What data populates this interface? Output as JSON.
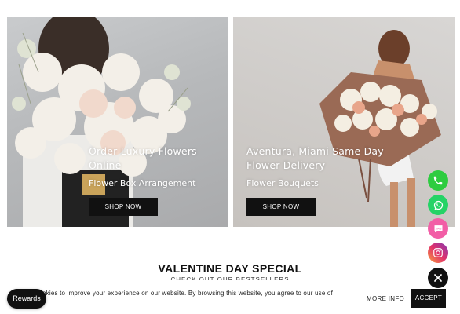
{
  "banners": [
    {
      "title_line1": "Order Luxury Flowers",
      "title_line2": "Online",
      "subtitle": "Flower Box Arrangement",
      "button": "SHOP NOW"
    },
    {
      "title_line1": "Aventura, Miami Same Day",
      "title_line2": "Flower Delivery",
      "subtitle": "Flower Bouquets",
      "button": "SHOP NOW"
    }
  ],
  "section": {
    "title": "VALENTINE DAY SPECIAL",
    "subtitle": "CHECK OUT OUR BESTSELLERS"
  },
  "cookie": {
    "text": "okies to improve your experience on our website. By browsing this website, you agree to our use of",
    "more_info": "MORE INFO",
    "accept": "ACCEPT"
  },
  "rewards": {
    "label": "Rewards"
  },
  "contact_buttons": [
    {
      "icon": "phone-icon",
      "color": "#2ecc40"
    },
    {
      "icon": "whatsapp-icon",
      "color": "#25d366"
    },
    {
      "icon": "sms-icon",
      "color": "#f25ea6"
    },
    {
      "icon": "instagram-icon",
      "color": "#c13584"
    },
    {
      "icon": "close-icon",
      "color": "#111111"
    }
  ]
}
